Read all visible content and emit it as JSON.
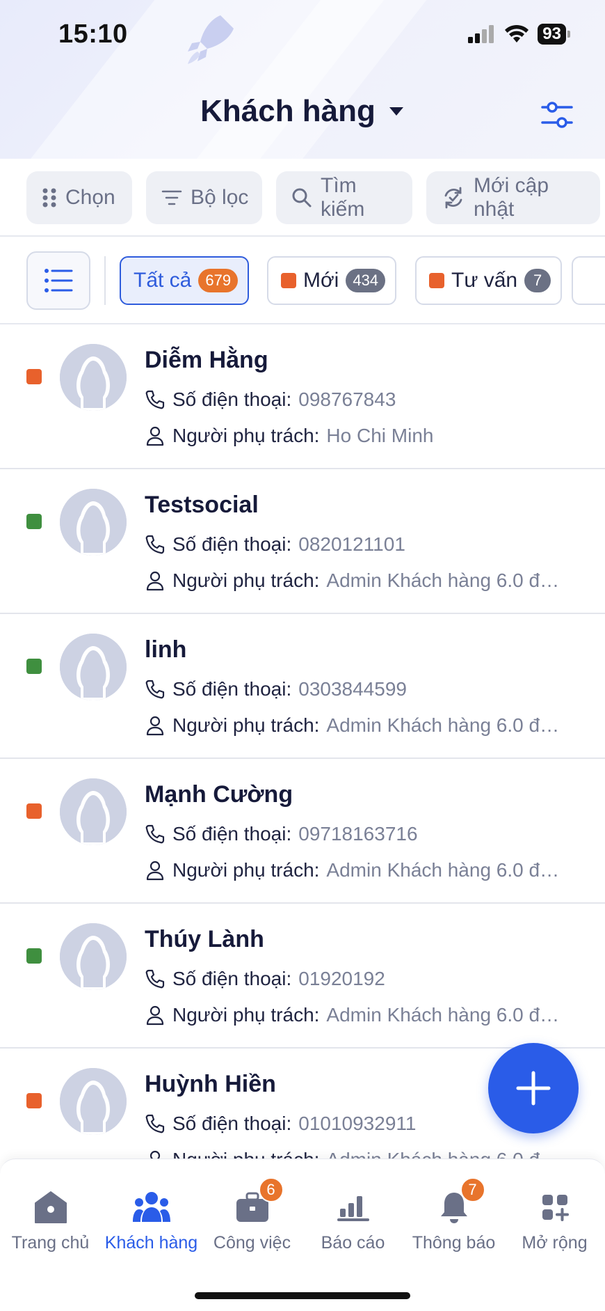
{
  "status_bar": {
    "time": "15:10",
    "battery": "93"
  },
  "header": {
    "title": "Khách hàng"
  },
  "toolbar": {
    "select_label": "Chọn",
    "filter_label": "Bộ lọc",
    "search_label": "Tìm kiếm",
    "recent_label": "Mới cập nhật"
  },
  "chips": [
    {
      "label": "Tất cả",
      "count": "679",
      "color": null,
      "active": true
    },
    {
      "label": "Mới",
      "count": "434",
      "color": "#e8612c",
      "active": false
    },
    {
      "label": "Tư vấn",
      "count": "7",
      "color": "#e8612c",
      "active": false
    }
  ],
  "customer_labels": {
    "phone": "Số điện thoại:",
    "owner": "Người phụ trách:"
  },
  "customers": [
    {
      "name": "Diễm Hằng",
      "phone": "098767843",
      "owner": "Ho Chi Minh",
      "status_color": "#e8612c"
    },
    {
      "name": "Testsocial",
      "phone": "0820121101",
      "owner": "Admin Khách hàng 6.0 để…",
      "status_color": "#3f8f3f"
    },
    {
      "name": "linh",
      "phone": "0303844599",
      "owner": "Admin Khách hàng 6.0 để…",
      "status_color": "#3f8f3f"
    },
    {
      "name": "Mạnh Cường",
      "phone": "09718163716",
      "owner": "Admin Khách hàng 6.0 để…",
      "status_color": "#e8612c"
    },
    {
      "name": "Thúy Lành",
      "phone": "01920192",
      "owner": "Admin Khách hàng 6.0 để…",
      "status_color": "#3f8f3f"
    },
    {
      "name": "Huỳnh Hiền",
      "phone": "01010932911",
      "owner": "Admin Khách hàng 6.0 để…",
      "status_color": "#e8612c"
    }
  ],
  "bottom_nav": [
    {
      "label": "Trang chủ",
      "icon": "home-icon",
      "badge": null,
      "active": false
    },
    {
      "label": "Khách hàng",
      "icon": "customers-icon",
      "badge": null,
      "active": true
    },
    {
      "label": "Công việc",
      "icon": "briefcase-icon",
      "badge": "6",
      "active": false
    },
    {
      "label": "Báo cáo",
      "icon": "chart-icon",
      "badge": null,
      "active": false
    },
    {
      "label": "Thông báo",
      "icon": "bell-icon",
      "badge": "7",
      "active": false
    },
    {
      "label": "Mở rộng",
      "icon": "grid-plus-icon",
      "badge": null,
      "active": false
    }
  ],
  "colors": {
    "accent": "#2a5ce8",
    "orange": "#e8612c",
    "green": "#3f8f3f"
  }
}
